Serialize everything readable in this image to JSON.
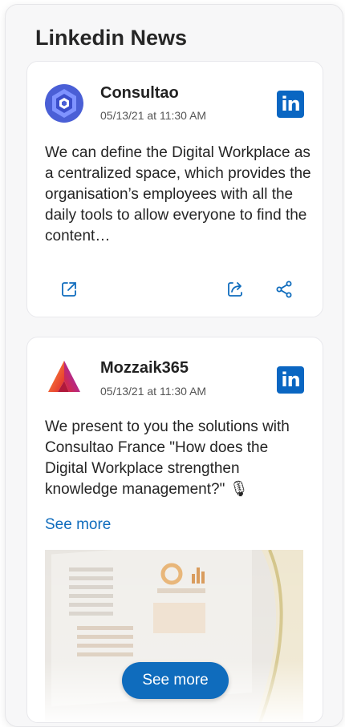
{
  "widget": {
    "title": "Linkedin News"
  },
  "posts": [
    {
      "author": "Consultao",
      "date": "05/13/21 at 11:30 AM",
      "text": "We can define the Digital Workplace as a centralized space, which provides the organisation’s employees with all the daily tools to allow everyone to find the content…",
      "network_logo": "in",
      "actions": [
        "open-external-icon",
        "share-icon",
        "share-network-icon"
      ]
    },
    {
      "author": "Mozzaik365",
      "date": "05/13/21 at 11:30 AM",
      "text": "We present to you the solutions with Consultao France \"How does the Digital Workplace strengthen knowledge management?\" 🎙",
      "see_more_link": "See more",
      "network_logo": "in"
    }
  ],
  "footer": {
    "see_more_button": "See more"
  },
  "colors": {
    "accent": "#0f6cbd",
    "linkedin": "#0a66c2"
  }
}
